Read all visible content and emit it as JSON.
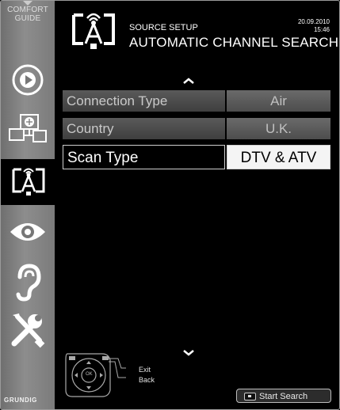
{
  "sidebar": {
    "comfort_guide": [
      "COMFORT",
      "GUIDE"
    ],
    "icons": [
      "play-icon",
      "globe-network-icon",
      "antenna-source-icon",
      "eye-icon",
      "ear-icon",
      "tools-icon"
    ],
    "active_index": 2,
    "brand": "GRUNDIG"
  },
  "header": {
    "subtitle": "SOURCE SETUP",
    "title": "AUTOMATIC CHANNEL SEARCH",
    "date": "20.09.2010",
    "time": "15:46",
    "icon": "antenna-source-icon"
  },
  "menu": {
    "rows": [
      {
        "label": "Connection Type",
        "value": "Air",
        "selected": false
      },
      {
        "label": "Country",
        "value": "U.K.",
        "selected": false
      },
      {
        "label": "Scan Type",
        "value": "DTV & ATV",
        "selected": true
      }
    ]
  },
  "footer": {
    "legend": [
      "Exit",
      "Back"
    ],
    "remote_ok": "OK",
    "start_search": "Start Search",
    "remote_icon": "remote-navigation-icon"
  },
  "colors": {
    "background": "#000000",
    "sidebar": "#8a8a8a",
    "selected_value_bg": "#f4f4f4"
  }
}
